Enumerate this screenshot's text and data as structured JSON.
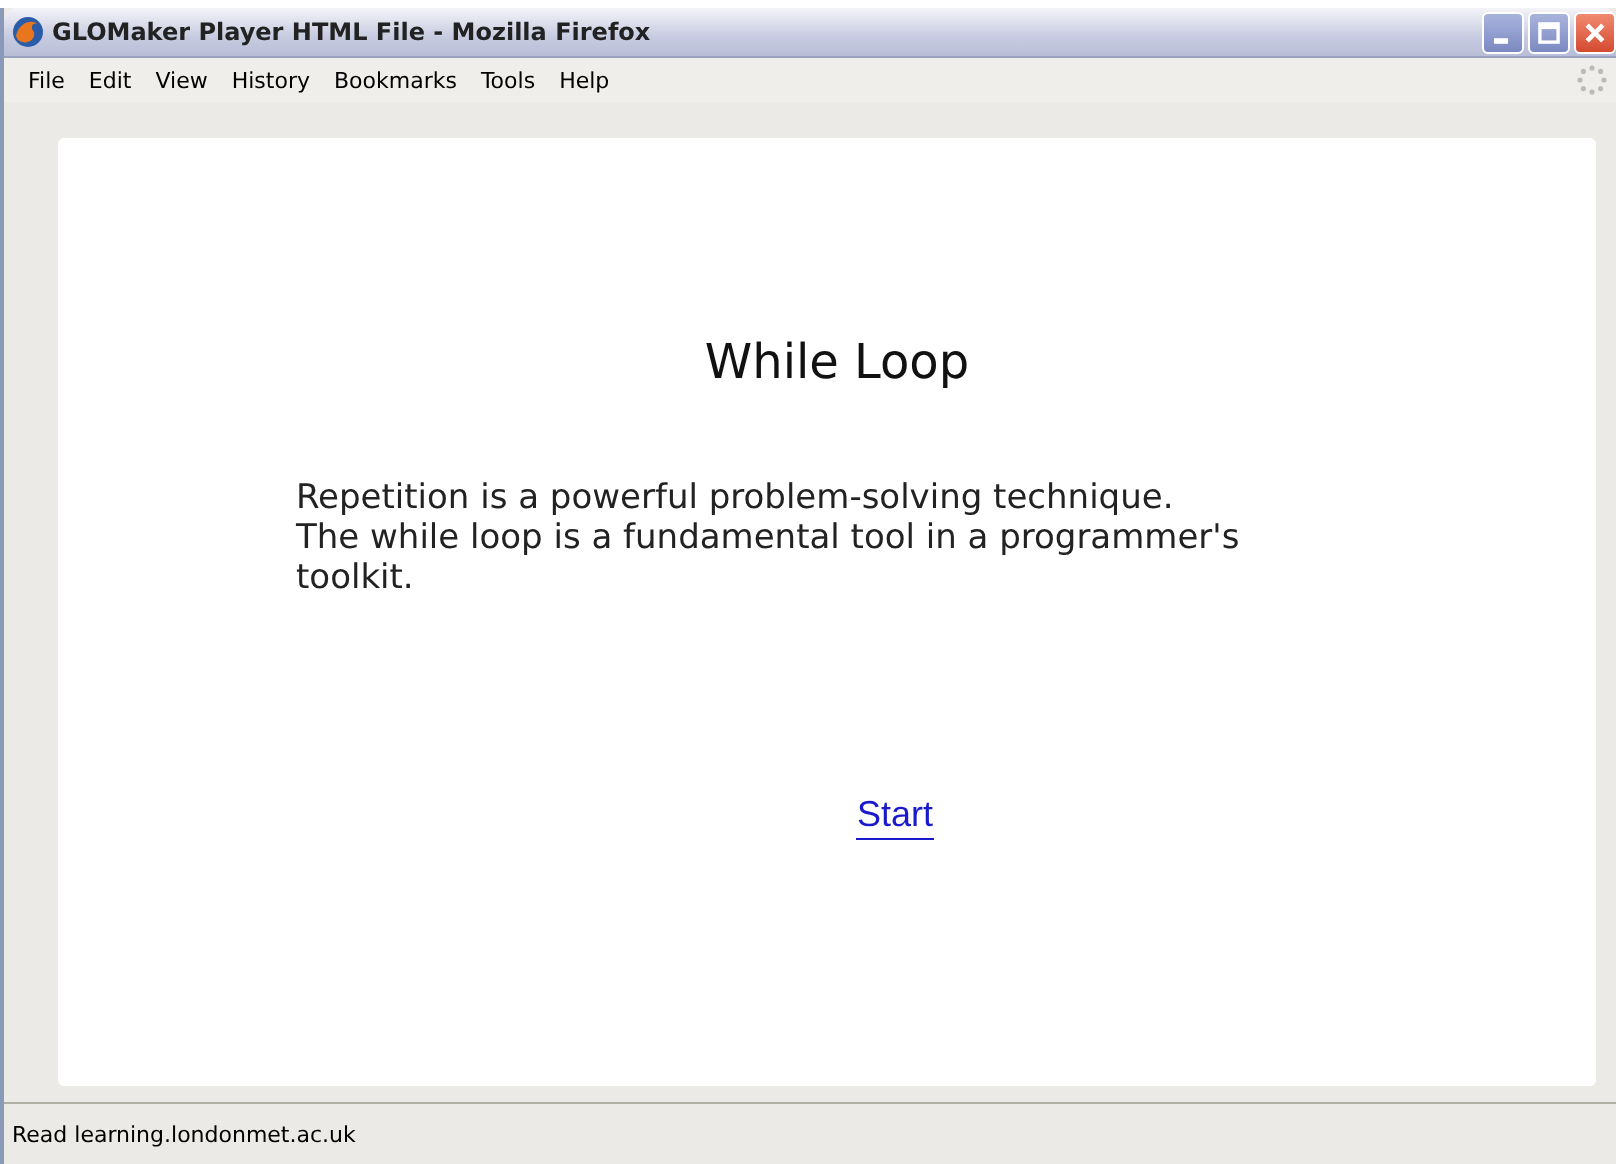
{
  "window": {
    "title": "GLOMaker Player HTML File - Mozilla Firefox"
  },
  "menu": [
    "File",
    "Edit",
    "View",
    "History",
    "Bookmarks",
    "Tools",
    "Help"
  ],
  "page": {
    "heading": "While Loop",
    "paragraphs": [
      "Repetition is a powerful problem-solving technique.",
      "The while loop is a fundamental tool in a programmer's toolkit."
    ],
    "link": "Start"
  },
  "status_bar": "Read learning.londonmet.ac.uk"
}
